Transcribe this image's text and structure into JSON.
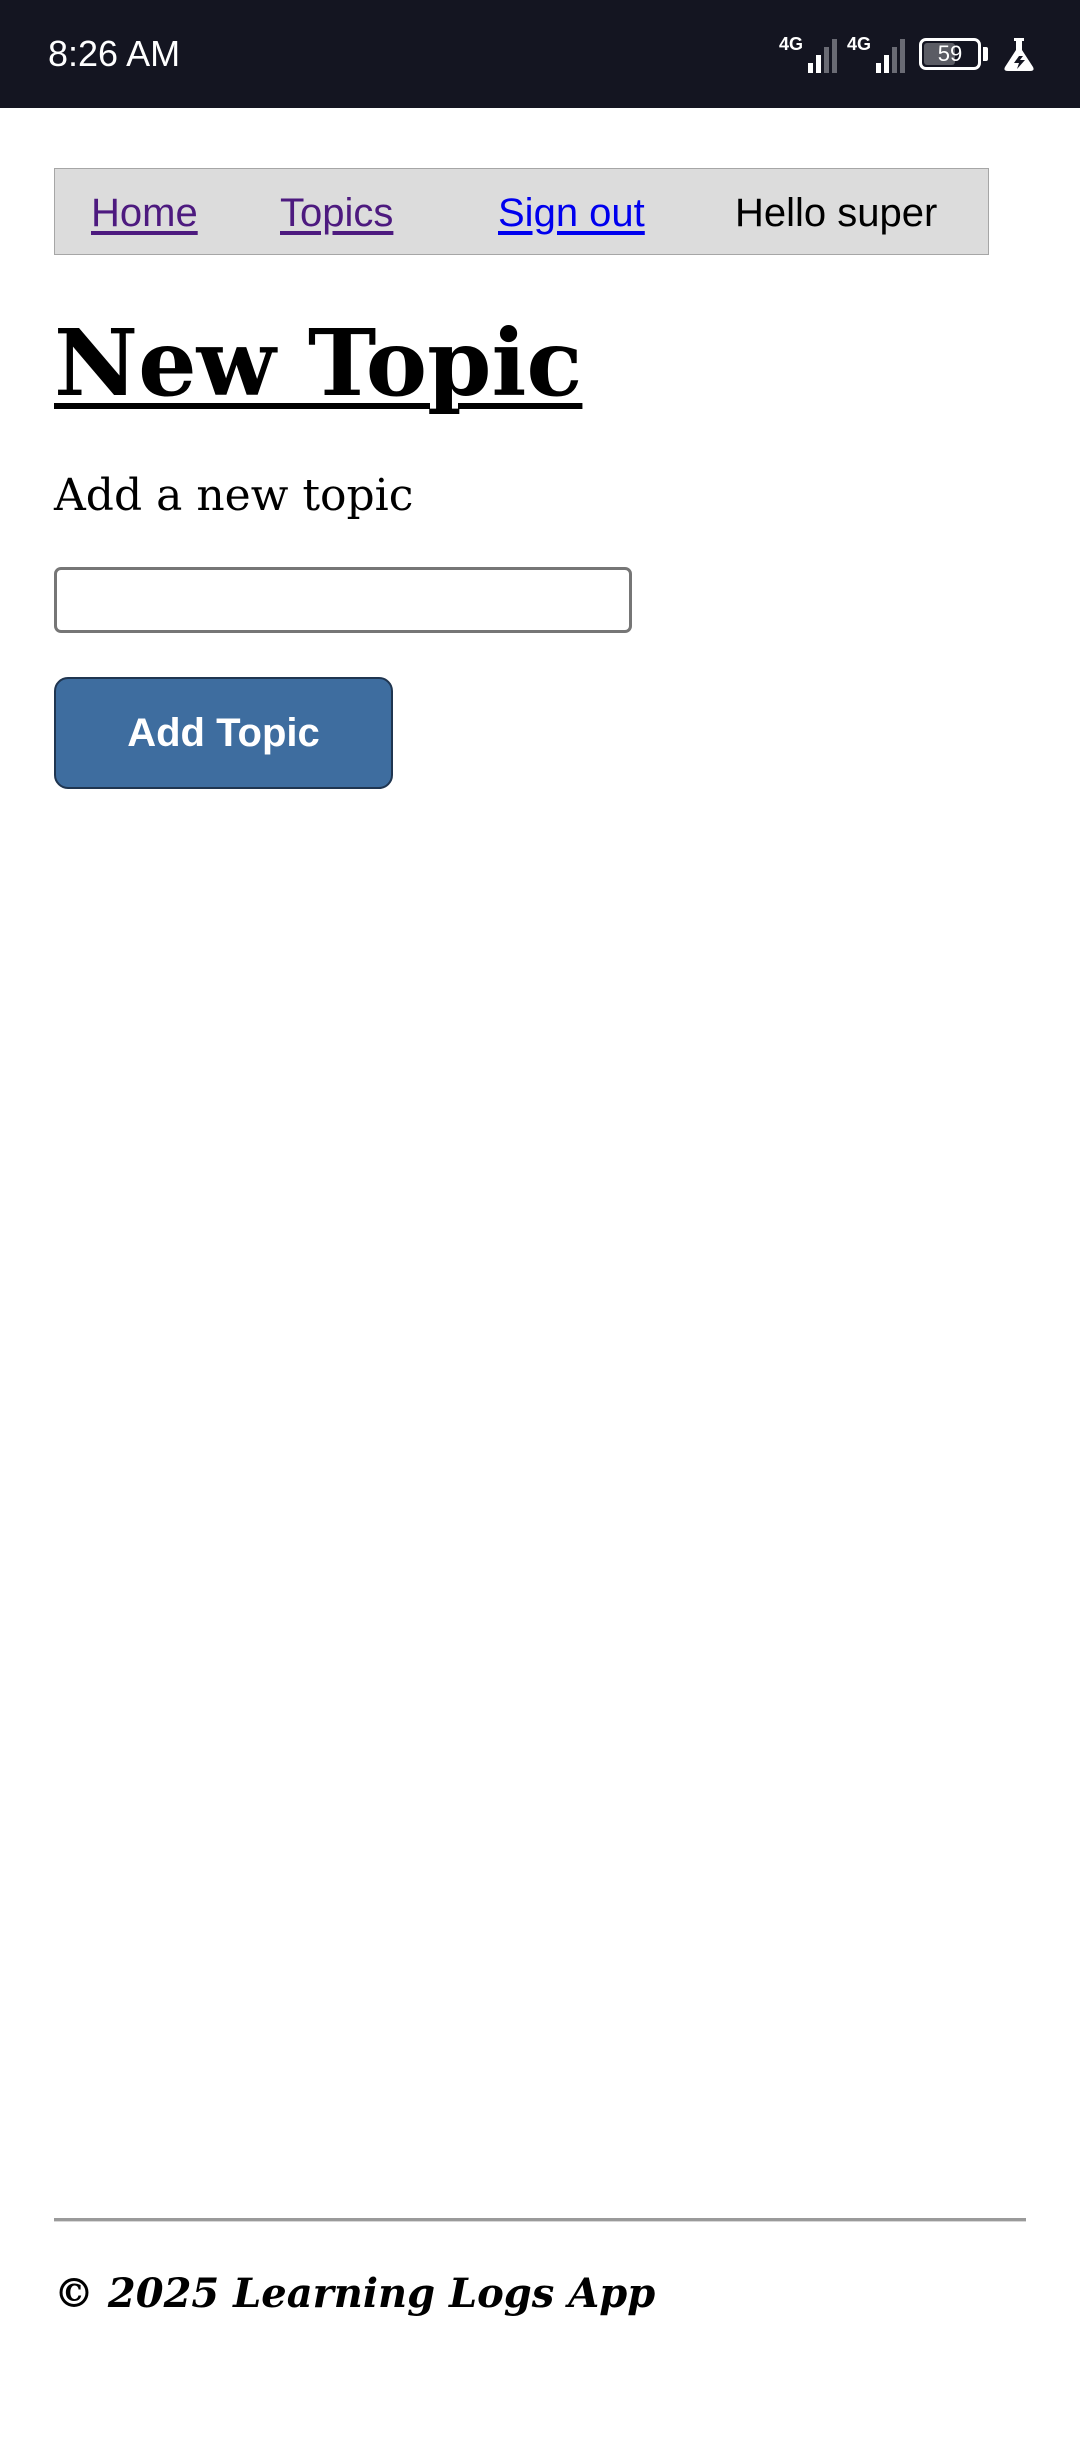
{
  "status_bar": {
    "time": "8:26 AM",
    "network_1": "4G",
    "network_2": "4G",
    "battery": "59",
    "battery_level": 0.59,
    "icons": [
      "signal-icon",
      "signal-icon",
      "battery-icon",
      "flask-icon"
    ]
  },
  "nav": {
    "home": "Home",
    "topics": "Topics",
    "sign_out": "Sign out",
    "greeting": "Hello super"
  },
  "page": {
    "title": "New Topic",
    "form_label": "Add a new topic",
    "input_value": "",
    "input_placeholder": "",
    "submit_label": "Add Topic"
  },
  "footer": {
    "text": "© 2025 Learning Logs App"
  },
  "colors": {
    "status_bar_bg": "#141521",
    "nav_bg": "#dcdcdc",
    "visited_link": "#4d1a7f",
    "link": "#0000ee",
    "button_bg": "#3e6d9f"
  }
}
